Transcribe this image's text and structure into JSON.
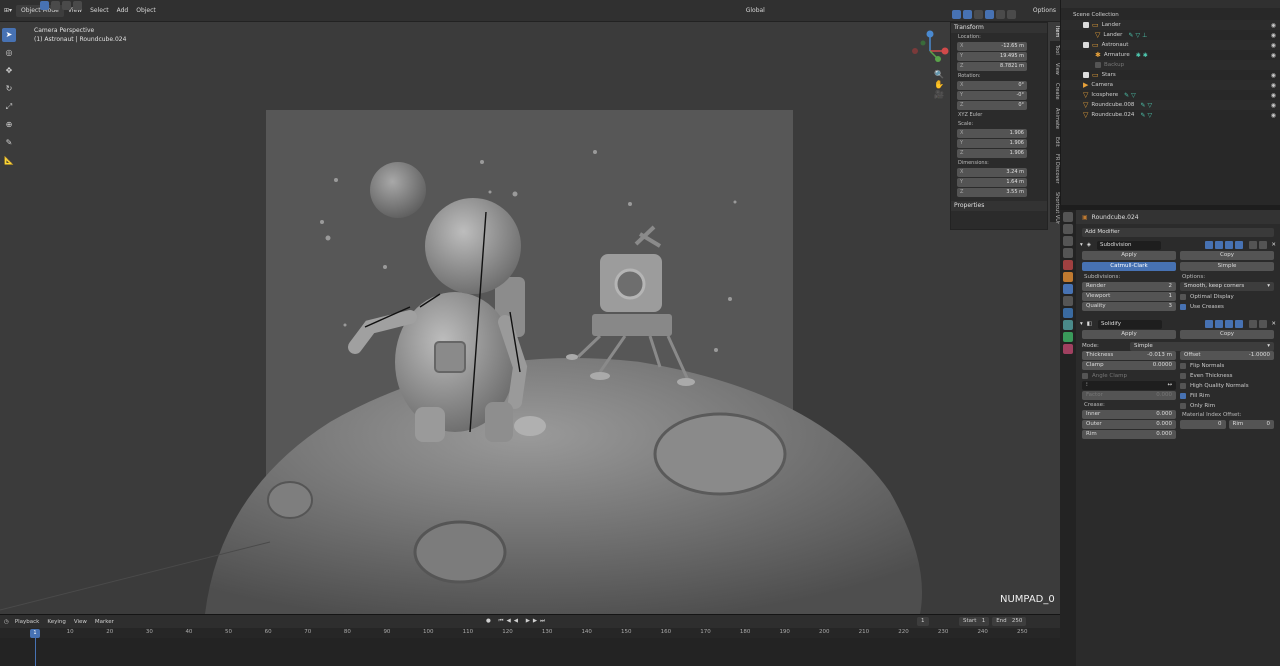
{
  "header": {
    "mode": "Object Mode",
    "menu": [
      "View",
      "Select",
      "Add",
      "Object"
    ],
    "orientation": "Global",
    "options": "Options"
  },
  "viewport": {
    "perspective": "Camera Perspective",
    "object_info": "(1) Astronaut | Roundcube.024",
    "hint": "NUMPAD_0"
  },
  "npanel": {
    "section_transform": "Transform",
    "location_label": "Location:",
    "location": [
      {
        "k": "X",
        "v": "-12.65 m"
      },
      {
        "k": "Y",
        "v": "19.495 m"
      },
      {
        "k": "Z",
        "v": "8.7821 m"
      }
    ],
    "rotation_label": "Rotation:",
    "rotation": [
      {
        "k": "X",
        "v": "0°"
      },
      {
        "k": "Y",
        "v": "-0°"
      },
      {
        "k": "Z",
        "v": "0°"
      }
    ],
    "rotation_mode": "XYZ Euler",
    "scale_label": "Scale:",
    "scale": [
      {
        "k": "X",
        "v": "1.906"
      },
      {
        "k": "Y",
        "v": "1.906"
      },
      {
        "k": "Z",
        "v": "1.906"
      }
    ],
    "dimensions_label": "Dimensions:",
    "dimensions": [
      {
        "k": "X",
        "v": "3.24 m"
      },
      {
        "k": "Y",
        "v": "1.64 m"
      },
      {
        "k": "Z",
        "v": "3.55 m"
      }
    ],
    "section_properties": "Properties",
    "tabs": [
      "Item",
      "Tool",
      "View",
      "Create",
      "Animate",
      "Edit",
      "FR Discover",
      "Shortcut VUr"
    ]
  },
  "outliner": {
    "title": "Scene Collection",
    "rows": [
      "Lander",
      "Lander",
      "Astronaut",
      "Armature",
      "Backup",
      "Stars",
      "Camera",
      "Icosphere",
      "Roundcube.008",
      "Roundcube.024"
    ]
  },
  "properties": {
    "object": "Roundcube.024",
    "add_modifier": "Add Modifier",
    "subdivision": {
      "name": "Subdivision",
      "apply": "Apply",
      "copy": "Copy",
      "catmull": "Catmull-Clark",
      "simple": "Simple",
      "subdivisions_label": "Subdivisions:",
      "options_label": "Options:",
      "render": {
        "k": "Render",
        "v": "2"
      },
      "viewport": {
        "k": "Viewport",
        "v": "1"
      },
      "quality": {
        "k": "Quality",
        "v": "3"
      },
      "uv_smooth": "Smooth, keep corners",
      "optimal_display": "Optimal Display",
      "use_creases": "Use Creases"
    },
    "solidify": {
      "name": "Solidify",
      "apply": "Apply",
      "copy": "Copy",
      "mode_label": "Mode:",
      "mode": "Simple",
      "thickness": {
        "k": "Thickness",
        "v": "-0.013 m"
      },
      "offset": {
        "k": "Offset",
        "v": "-1.0000"
      },
      "clamp": {
        "k": "Clamp",
        "v": "0.0000"
      },
      "angle_clamp": "Angle Clamp",
      "flip_normals": "Flip Normals",
      "even_thickness": "Even Thickness",
      "hq_normals": "High Quality Normals",
      "fill_rim": "Fill Rim",
      "only_rim": "Only Rim",
      "factor": {
        "k": "Factor",
        "v": "0.000"
      },
      "crease_label": "Crease:",
      "inner": {
        "k": "Inner",
        "v": "0.000"
      },
      "outer": {
        "k": "Outer",
        "v": "0.000"
      },
      "rim": {
        "k": "Rim",
        "v": "0.000"
      },
      "mat_offset_label": "Material Index Offset:",
      "mat_offset": "0",
      "mat_rim": {
        "k": "Rim",
        "v": "0"
      }
    }
  },
  "timeline": {
    "menu": [
      "Playback",
      "Keying",
      "View",
      "Marker"
    ],
    "current_frame": "1",
    "start_label": "Start",
    "start": "1",
    "end_label": "End",
    "end": "250",
    "ticks": [
      "1",
      "10",
      "20",
      "30",
      "40",
      "50",
      "60",
      "70",
      "80",
      "90",
      "100",
      "110",
      "120",
      "130",
      "140",
      "150",
      "160",
      "170",
      "180",
      "190",
      "200",
      "210",
      "220",
      "230",
      "240",
      "250"
    ]
  },
  "colors": {
    "accent": "#4772b3",
    "object_orange": "#e8a23a"
  }
}
